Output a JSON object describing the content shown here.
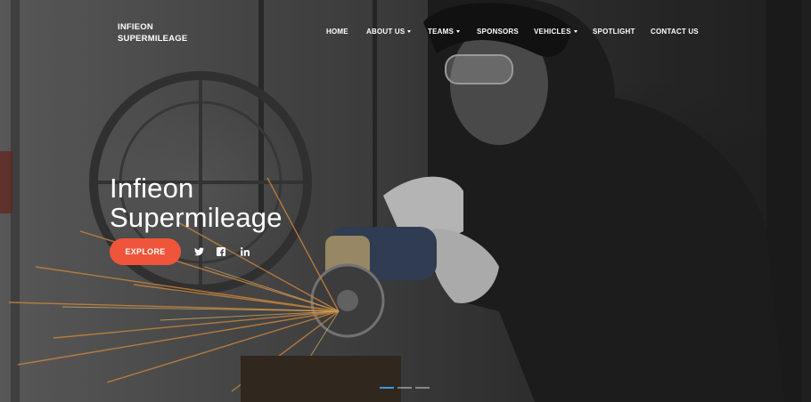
{
  "brand": {
    "line1": "INFIEON",
    "line2": "SUPERMILEAGE"
  },
  "nav": {
    "items": [
      {
        "label": "HOME",
        "has_dropdown": false
      },
      {
        "label": "ABOUT US",
        "has_dropdown": true
      },
      {
        "label": "TEAMS",
        "has_dropdown": true
      },
      {
        "label": "SPONSORS",
        "has_dropdown": false
      },
      {
        "label": "VEHICLES",
        "has_dropdown": true
      },
      {
        "label": "SPOTLIGHT",
        "has_dropdown": false
      },
      {
        "label": "CONTACT US",
        "has_dropdown": false
      }
    ]
  },
  "hero": {
    "title_line1": "Infieon",
    "title_line2": "Supermileage",
    "cta_label": "EXPLORE",
    "social": [
      "twitter-icon",
      "facebook-icon",
      "linkedin-icon"
    ],
    "slides": {
      "count": 3,
      "active": 1
    }
  },
  "colors": {
    "accent": "#f0553b",
    "indicator_active": "#3d9ad9"
  }
}
